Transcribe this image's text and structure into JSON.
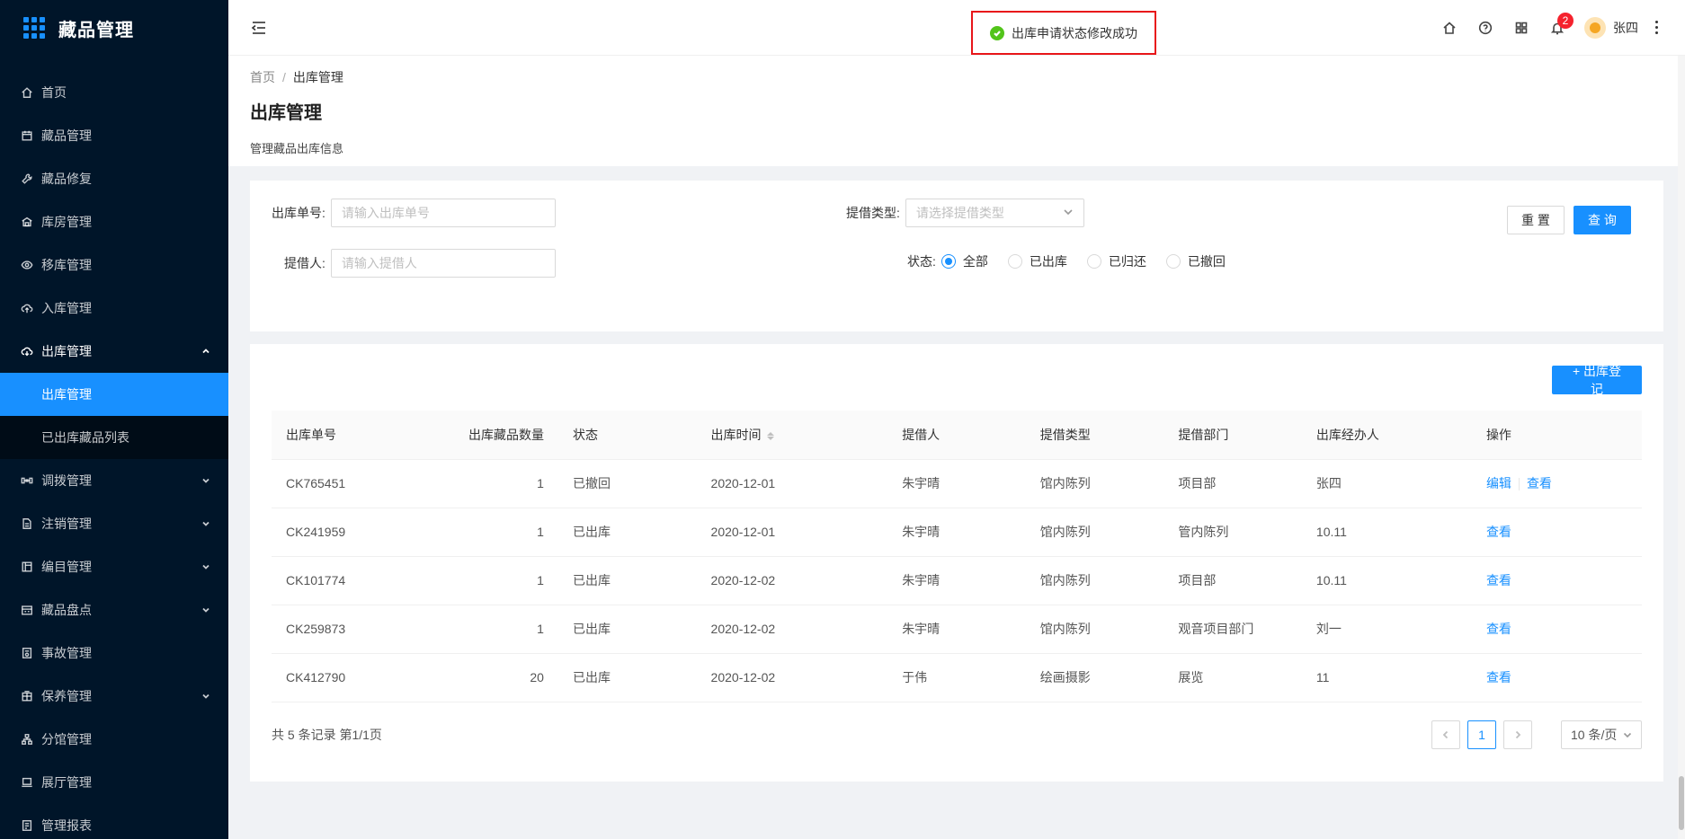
{
  "app": {
    "title": "藏品管理"
  },
  "sidebar": {
    "items": [
      {
        "label": "首页",
        "icon": "home-icon"
      },
      {
        "label": "藏品管理",
        "icon": "calendar-icon"
      },
      {
        "label": "藏品修复",
        "icon": "wrench-icon"
      },
      {
        "label": "库房管理",
        "icon": "warehouse-icon"
      },
      {
        "label": "移库管理",
        "icon": "eye-icon"
      },
      {
        "label": "入库管理",
        "icon": "cloud-upload-icon"
      },
      {
        "label": "出库管理",
        "icon": "cloud-download-icon"
      },
      {
        "label": "调拨管理",
        "icon": "transfer-icon"
      },
      {
        "label": "注销管理",
        "icon": "file-icon"
      },
      {
        "label": "编目管理",
        "icon": "catalog-icon"
      },
      {
        "label": "藏品盘点",
        "icon": "inventory-icon"
      },
      {
        "label": "事故管理",
        "icon": "document-icon"
      },
      {
        "label": "保养管理",
        "icon": "building-icon"
      },
      {
        "label": "分馆管理",
        "icon": "cluster-icon"
      },
      {
        "label": "展厅管理",
        "icon": "laptop-icon"
      },
      {
        "label": "管理报表",
        "icon": "report-icon"
      }
    ],
    "submenu": [
      {
        "label": "出库管理"
      },
      {
        "label": "已出库藏品列表"
      }
    ]
  },
  "toast": {
    "message": "出库申请状态修改成功"
  },
  "header": {
    "username": "张四",
    "notification_count": "2"
  },
  "breadcrumb": {
    "home": "首页",
    "separator": "/",
    "current": "出库管理"
  },
  "page": {
    "title": "出库管理",
    "description": "管理藏品出库信息"
  },
  "filters": {
    "order_no_label": "出库单号:",
    "order_no_placeholder": "请输入出库单号",
    "type_label": "提借类型:",
    "type_placeholder": "请选择提借类型",
    "borrower_label": "提借人:",
    "borrower_placeholder": "请输入提借人",
    "status_label": "状态:",
    "status_options": [
      "全部",
      "已出库",
      "已归还",
      "已撤回"
    ],
    "status_selected": "全部",
    "reset_label": "重 置",
    "query_label": "查 询"
  },
  "table": {
    "add_label": "+ 出库登记",
    "columns": [
      "出库单号",
      "出库藏品数量",
      "状态",
      "出库时间",
      "提借人",
      "提借类型",
      "提借部门",
      "出库经办人",
      "操作"
    ],
    "rows": [
      {
        "no": "CK765451",
        "qty": "1",
        "status": "已撤回",
        "time": "2020-12-01",
        "borrower": "朱宇晴",
        "type": "馆内陈列",
        "dept": "项目部",
        "handler": "张四",
        "actions": [
          "编辑",
          "查看"
        ]
      },
      {
        "no": "CK241959",
        "qty": "1",
        "status": "已出库",
        "time": "2020-12-01",
        "borrower": "朱宇晴",
        "type": "馆内陈列",
        "dept": "管内陈列",
        "handler": "10.11",
        "actions": [
          "查看"
        ]
      },
      {
        "no": "CK101774",
        "qty": "1",
        "status": "已出库",
        "time": "2020-12-02",
        "borrower": "朱宇晴",
        "type": "馆内陈列",
        "dept": "项目部",
        "handler": "10.11",
        "actions": [
          "查看"
        ]
      },
      {
        "no": "CK259873",
        "qty": "1",
        "status": "已出库",
        "time": "2020-12-02",
        "borrower": "朱宇晴",
        "type": "馆内陈列",
        "dept": "观音项目部门",
        "handler": "刘一",
        "actions": [
          "查看"
        ]
      },
      {
        "no": "CK412790",
        "qty": "20",
        "status": "已出库",
        "time": "2020-12-02",
        "borrower": "于伟",
        "type": "绘画摄影",
        "dept": "展览",
        "handler": "11",
        "actions": [
          "查看"
        ]
      }
    ],
    "total_text": "共 5 条记录 第1/1页",
    "current_page": "1",
    "page_size": "10 条/页"
  },
  "colors": {
    "primary": "#1890ff",
    "sidebar_bg": "#001529",
    "success": "#52c41a",
    "danger": "#f5222d"
  }
}
